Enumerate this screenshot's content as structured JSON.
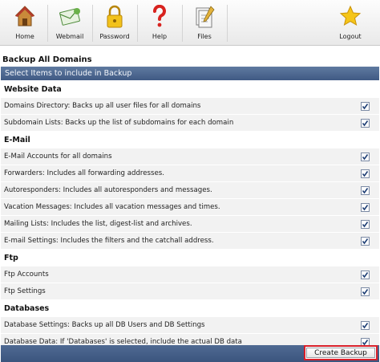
{
  "toolbar": {
    "items": [
      {
        "label": "Home",
        "icon": "home-icon"
      },
      {
        "label": "Webmail",
        "icon": "webmail-icon"
      },
      {
        "label": "Password",
        "icon": "lock-icon"
      },
      {
        "label": "Help",
        "icon": "question-icon"
      },
      {
        "label": "Files",
        "icon": "files-icon"
      },
      {
        "label": "Logout",
        "icon": "star-icon"
      }
    ]
  },
  "page": {
    "title": "Backup All Domains",
    "header": "Select Items to include in Backup"
  },
  "sections": [
    {
      "title": "Website Data",
      "items": [
        {
          "label": "Domains Directory: Backs up all user files for all domains",
          "checked": true
        },
        {
          "label": "Subdomain Lists: Backs up the list of subdomains for each domain",
          "checked": true
        }
      ]
    },
    {
      "title": "E-Mail",
      "items": [
        {
          "label": "E-Mail Accounts for all domains",
          "checked": true
        },
        {
          "label": "Forwarders: Includes all forwarding addresses.",
          "checked": true
        },
        {
          "label": "Autoresponders: Includes all autoresponders and messages.",
          "checked": true
        },
        {
          "label": "Vacation Messages: Includes all vacation messages and times.",
          "checked": true
        },
        {
          "label": "Mailing Lists: Includes the list, digest-list and archives.",
          "checked": true
        },
        {
          "label": "E-mail Settings: Includes the filters and the catchall address.",
          "checked": true
        }
      ]
    },
    {
      "title": "Ftp",
      "items": [
        {
          "label": "Ftp Accounts",
          "checked": true
        },
        {
          "label": "Ftp Settings",
          "checked": true
        }
      ]
    },
    {
      "title": "Databases",
      "items": [
        {
          "label": "Database Settings: Backs up all DB Users and DB Settings",
          "checked": true
        },
        {
          "label": "Database Data: If 'Databases' is selected, include the actual DB data",
          "checked": true
        }
      ]
    }
  ],
  "actions": {
    "create_backup": "Create Backup"
  },
  "colors": {
    "header_bar": "#4a648c",
    "highlight": "#d8202a"
  }
}
